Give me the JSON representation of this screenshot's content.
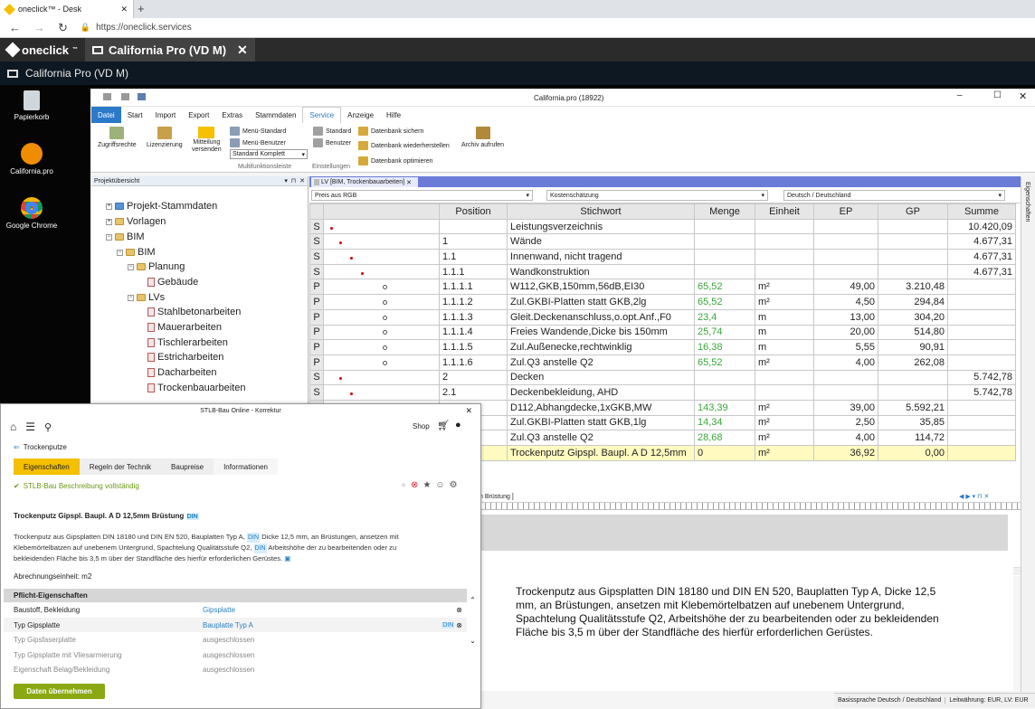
{
  "browser": {
    "tab_title": "oneclick™ - Desk",
    "new_tab": "+",
    "url": "https://oneclick.services"
  },
  "appbar": {
    "brand": "oneclick",
    "brand_sup": "™",
    "app_tab": "California Pro (VD M)",
    "close": "✕"
  },
  "subbar": {
    "title": "California Pro (VD M)"
  },
  "desktop": {
    "icons": [
      {
        "label": "Papierkorb"
      },
      {
        "label": "California.pro"
      },
      {
        "label": "Google Chrome"
      }
    ]
  },
  "window": {
    "title": "California.pro (18922)",
    "menu": [
      "Datei",
      "Start",
      "Import",
      "Export",
      "Extras",
      "Stammdaten",
      "Service",
      "Anzeige",
      "Hilfe"
    ],
    "ribbon": {
      "zugriffsrechte": "Zugriffsrechte",
      "lizenzierung": "Lizenzierung",
      "mitteilung1": "Mitteilung",
      "mitteilung2": "versenden",
      "menu_standard": "Menü-Standard",
      "menu_benutzer": "Menü-Benutzer",
      "select_value": "Standard Komplett",
      "group_multi": "Multifunktionsleiste",
      "standard": "Standard",
      "benutzer": "Benutzer",
      "group_einst": "Einstellungen",
      "db_sichern": "Datenbank sichern",
      "db_wieder": "Datenbank wiederherstellen",
      "db_opt": "Datenbank optimieren",
      "archiv": "Archiv aufrufen"
    }
  },
  "tree": {
    "header": "Projektübersicht",
    "nodes": [
      "Projekt-Stammdaten",
      "Vorlagen",
      "BIM",
      "BIM",
      "Planung",
      "Gebäude",
      "LVs",
      "Stahlbetonarbeiten",
      "Mauerarbeiten",
      "Tischlerarbeiten",
      "Estricharbeiten",
      "Dacharbeiten",
      "Trockenbauarbeiten"
    ]
  },
  "lv": {
    "tab": "LV [BIM, Trockenbauarbeiten]",
    "filter1": "Preis aus RGB",
    "filter2": "Kostenschätzung",
    "filter3": "Deutsch / Deutschland",
    "columns": [
      "Position",
      "Stichwort",
      "Menge",
      "Einheit",
      "EP",
      "GP",
      "Summe"
    ],
    "rows": [
      {
        "t": "S",
        "pos": "",
        "kw": "Leistungsverzeichnis",
        "menge": "",
        "einheit": "",
        "ep": "",
        "gp": "",
        "summe": "10.420,09"
      },
      {
        "t": "S",
        "pos": "1",
        "kw": "Wände",
        "menge": "",
        "einheit": "",
        "ep": "",
        "gp": "",
        "summe": "4.677,31"
      },
      {
        "t": "S",
        "pos": "1.1",
        "kw": "Innenwand, nicht tragend",
        "menge": "",
        "einheit": "",
        "ep": "",
        "gp": "",
        "summe": "4.677,31"
      },
      {
        "t": "S",
        "pos": "1.1.1",
        "kw": "Wandkonstruktion",
        "menge": "",
        "einheit": "",
        "ep": "",
        "gp": "",
        "summe": "4.677,31"
      },
      {
        "t": "P",
        "pos": "1.1.1.1",
        "kw": "W112,GKB,150mm,56dB,EI30",
        "menge": "65,52",
        "einheit": "m²",
        "ep": "49,00",
        "gp": "3.210,48",
        "summe": ""
      },
      {
        "t": "P",
        "pos": "1.1.1.2",
        "kw": "Zul.GKBI-Platten statt GKB,2lg",
        "menge": "65,52",
        "einheit": "m²",
        "ep": "4,50",
        "gp": "294,84",
        "summe": ""
      },
      {
        "t": "P",
        "pos": "1.1.1.3",
        "kw": "Gleit.Deckenanschluss,o.opt.Anf.,F0",
        "menge": "23,4",
        "einheit": "m",
        "ep": "13,00",
        "gp": "304,20",
        "summe": ""
      },
      {
        "t": "P",
        "pos": "1.1.1.4",
        "kw": "Freies Wandende,Dicke bis 150mm",
        "menge": "25,74",
        "einheit": "m",
        "ep": "20,00",
        "gp": "514,80",
        "summe": ""
      },
      {
        "t": "P",
        "pos": "1.1.1.5",
        "kw": "Zul.Außenecke,rechtwinklig",
        "menge": "16,38",
        "einheit": "m",
        "ep": "5,55",
        "gp": "90,91",
        "summe": ""
      },
      {
        "t": "P",
        "pos": "1.1.1.6",
        "kw": "Zul.Q3 anstelle Q2",
        "menge": "65,52",
        "einheit": "m²",
        "ep": "4,00",
        "gp": "262,08",
        "summe": ""
      },
      {
        "t": "S",
        "pos": "2",
        "kw": "Decken",
        "menge": "",
        "einheit": "",
        "ep": "",
        "gp": "",
        "summe": "5.742,78"
      },
      {
        "t": "S",
        "pos": "2.1",
        "kw": "Deckenbekleidung, AHD",
        "menge": "",
        "einheit": "",
        "ep": "",
        "gp": "",
        "summe": "5.742,78"
      },
      {
        "t": "",
        "pos": "",
        "kw": "D112,Abhangdecke,1xGKB,MW",
        "menge": "143,39",
        "einheit": "m²",
        "ep": "39,00",
        "gp": "5.592,21",
        "summe": ""
      },
      {
        "t": "",
        "pos": "",
        "kw": "Zul.GKBI-Platten statt GKB,1lg",
        "menge": "14,34",
        "einheit": "m²",
        "ep": "2,50",
        "gp": "35,85",
        "summe": ""
      },
      {
        "t": "",
        "pos": "",
        "kw": "Zul.Q3 anstelle Q2",
        "menge": "28,68",
        "einheit": "m²",
        "ep": "4,00",
        "gp": "114,72",
        "summe": ""
      },
      {
        "t": "",
        "pos": "",
        "kw": "Trockenputz Gipspl. Baupl. A D 12,5mm",
        "menge": "0",
        "einheit": "m²",
        "ep": "36,92",
        "gp": "0,00",
        "summe": ""
      }
    ]
  },
  "bottom": {
    "tab_fragment": "n Brüstung ]",
    "text": "Trockenputz aus Gipsplatten DIN 18180 und DIN EN 520, Bauplatten Typ A, Dicke 12,5 mm, an Brüstungen, ansetzen mit Klebemörtelbatzen auf unebenem Untergrund, Spachtelung Qualitätsstufe Q2, Arbeitshöhe der zu bearbeitenden oder zu bekleidenden Fläche bis 3,5 m über der Standfläche des hierfür erforderlichen Gerüstes.",
    "status1": "Basissprache Deutsch / Deutschland",
    "status2": "Leitwährung: EUR, LV: EUR",
    "side_label": "Eigenschaften"
  },
  "stlb": {
    "title": "STLB-Bau Online - Korrektur",
    "shop": "Shop",
    "back": "Trockenputze",
    "tabs": [
      "Eigenschaften",
      "Regeln der Technik",
      "Baupreise",
      "Informationen"
    ],
    "status": "STLB-Bau Beschreibung vollständig",
    "heading": "Trockenputz Gipspl. Baupl. A D 12,5mm Brüstung",
    "din": "DIN",
    "desc_a": "Trockenputz aus Gipsplatten DIN 18180 und DIN EN 520, Bauplatten Typ A,",
    "desc_b": "Dicke 12,5 mm, an Brüstungen, ansetzen mit",
    "desc_c": "Klebemörtelbatzen auf unebenem Untergrund, Spachtelung Qualitätsstufe Q2,",
    "desc_d": "Arbeitshöhe der zu bearbeitenden oder zu",
    "desc_e": "bekleidenden Fläche bis 3,5 m über der Standfläche des hierfür erforderlichen Gerüstes.",
    "unit": "Abrechnungseinheit: m2",
    "section": "Pflicht-Eigenschaften",
    "props": [
      {
        "k": "Baustoff, Bekleidung",
        "v": "Gipsplatte",
        "style": "blue"
      },
      {
        "k": "Typ Gipsplatte",
        "v": "Bauplatte Typ A",
        "style": "blue"
      },
      {
        "k": "Typ Gipsfaserplatte",
        "v": "ausgeschlossen",
        "style": "gray"
      },
      {
        "k": "Typ Gipsplatte mit Vliesarmierung",
        "v": "ausgeschlossen",
        "style": "gray"
      },
      {
        "k": "Eigenschaft Belag/Bekleidung",
        "v": "ausgeschlossen",
        "style": "gray"
      }
    ],
    "button": "Daten übernehmen"
  }
}
